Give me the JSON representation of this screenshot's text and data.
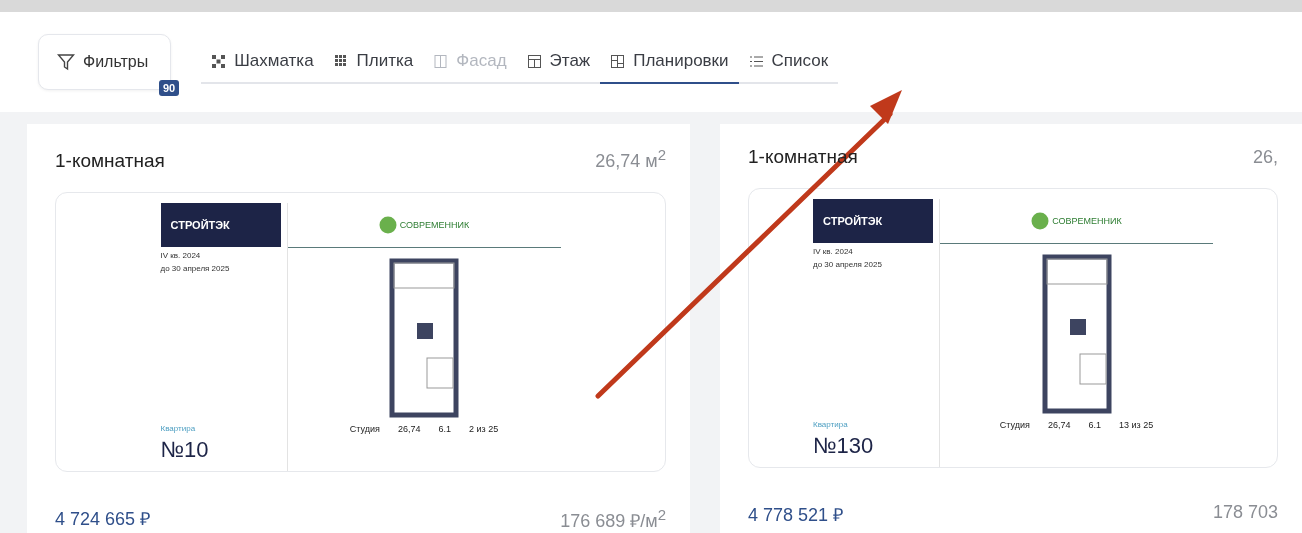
{
  "toolbar": {
    "filter_button": {
      "label": "Фильтры",
      "badge": "90"
    },
    "tabs": [
      {
        "label": "Шахматка",
        "selected": false,
        "disabled": false
      },
      {
        "label": "Плитка",
        "selected": false,
        "disabled": false
      },
      {
        "label": "Фасад",
        "selected": false,
        "disabled": true
      },
      {
        "label": "Этаж",
        "selected": false,
        "disabled": false
      },
      {
        "label": "Планировки",
        "selected": true,
        "disabled": false
      },
      {
        "label": "Список",
        "selected": false,
        "disabled": false
      }
    ]
  },
  "cards": [
    {
      "title": "1-комнатная",
      "area": "26,74 м$^{2}$",
      "plan": {
        "developer": "СТРОЙТЭК",
        "complex": "СОВРЕМЕННИК",
        "delivery": "IV кв. 2024",
        "keys": "до 30 апреля 2025",
        "apartment_label": "Квартира",
        "apartment_number": "№10",
        "stats": [
          "Студия",
          "26,74",
          "6.1",
          "2 из 25"
        ]
      },
      "price": "4 724 665 ₽",
      "price_per_m2": "176 689 ₽/м$^{2}$"
    },
    {
      "title": "1-комнатная",
      "area": "26,",
      "plan": {
        "developer": "СТРОЙТЭК",
        "complex": "СОВРЕМЕННИК",
        "delivery": "IV кв. 2024",
        "keys": "до 30 апреля 2025",
        "apartment_label": "Квартира",
        "apartment_number": "№130",
        "stats": [
          "Студия",
          "26,74",
          "6.1",
          "13 из 25"
        ]
      },
      "price": "4 778 521 ₽",
      "price_per_m2": "178 703"
    }
  ],
  "annotation": {
    "kind": "arrow"
  }
}
